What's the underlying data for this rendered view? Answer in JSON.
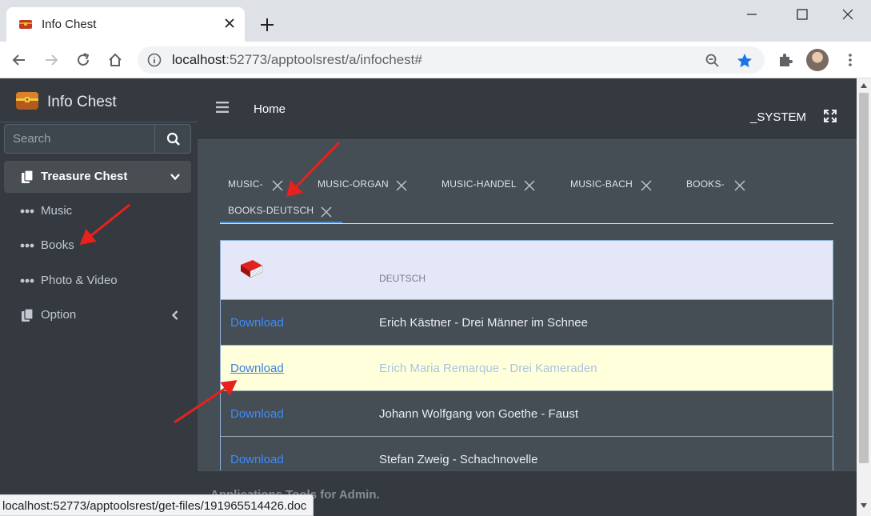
{
  "browser": {
    "tab_title": "Info Chest",
    "url_host": "localhost",
    "url_rest": ":52773/apptoolsrest/a/infochest#",
    "star_color": "#1a73e8"
  },
  "app": {
    "brand": "Info Chest",
    "search_placeholder": "Search",
    "nav": [
      {
        "label": "Treasure Chest",
        "icon": "copy-icon",
        "active": true
      },
      {
        "label": "Music",
        "icon": "dots-icon"
      },
      {
        "label": "Books",
        "icon": "dots-icon"
      },
      {
        "label": "Photo & Video",
        "icon": "dots-icon"
      },
      {
        "label": "Option",
        "icon": "copy-icon"
      }
    ],
    "header": {
      "home": "Home",
      "user": "_SYSTEM"
    },
    "tabs": [
      {
        "label": "MUSIC-"
      },
      {
        "label": "MUSIC-ORGAN"
      },
      {
        "label": "MUSIC-HANDEL"
      },
      {
        "label": "MUSIC-BACH"
      },
      {
        "label": "BOOKS-"
      },
      {
        "label": "BOOKS-DEUTSCH",
        "active": true
      }
    ],
    "table": {
      "column_header": "DEUTSCH",
      "rows": [
        {
          "link": "Download",
          "title": "Erich Kästner - Drei Männer im Schnee"
        },
        {
          "link": "Download",
          "title": "Erich Maria Remarque - Drei Kameraden",
          "hovered": true
        },
        {
          "link": "Download",
          "title": "Johann Wolfgang von Goethe - Faust"
        },
        {
          "link": "Download",
          "title": "Stefan Zweig - Schachnovelle"
        }
      ]
    },
    "footer": "Applications Tools for Admin."
  },
  "status_url": "localhost:52773/apptoolsrest/get-files/191965514426.doc",
  "colors": {
    "sidebar": "#343a40",
    "content": "#454d55",
    "link": "#3c8dff",
    "annotation_arrow": "#e8211c"
  }
}
